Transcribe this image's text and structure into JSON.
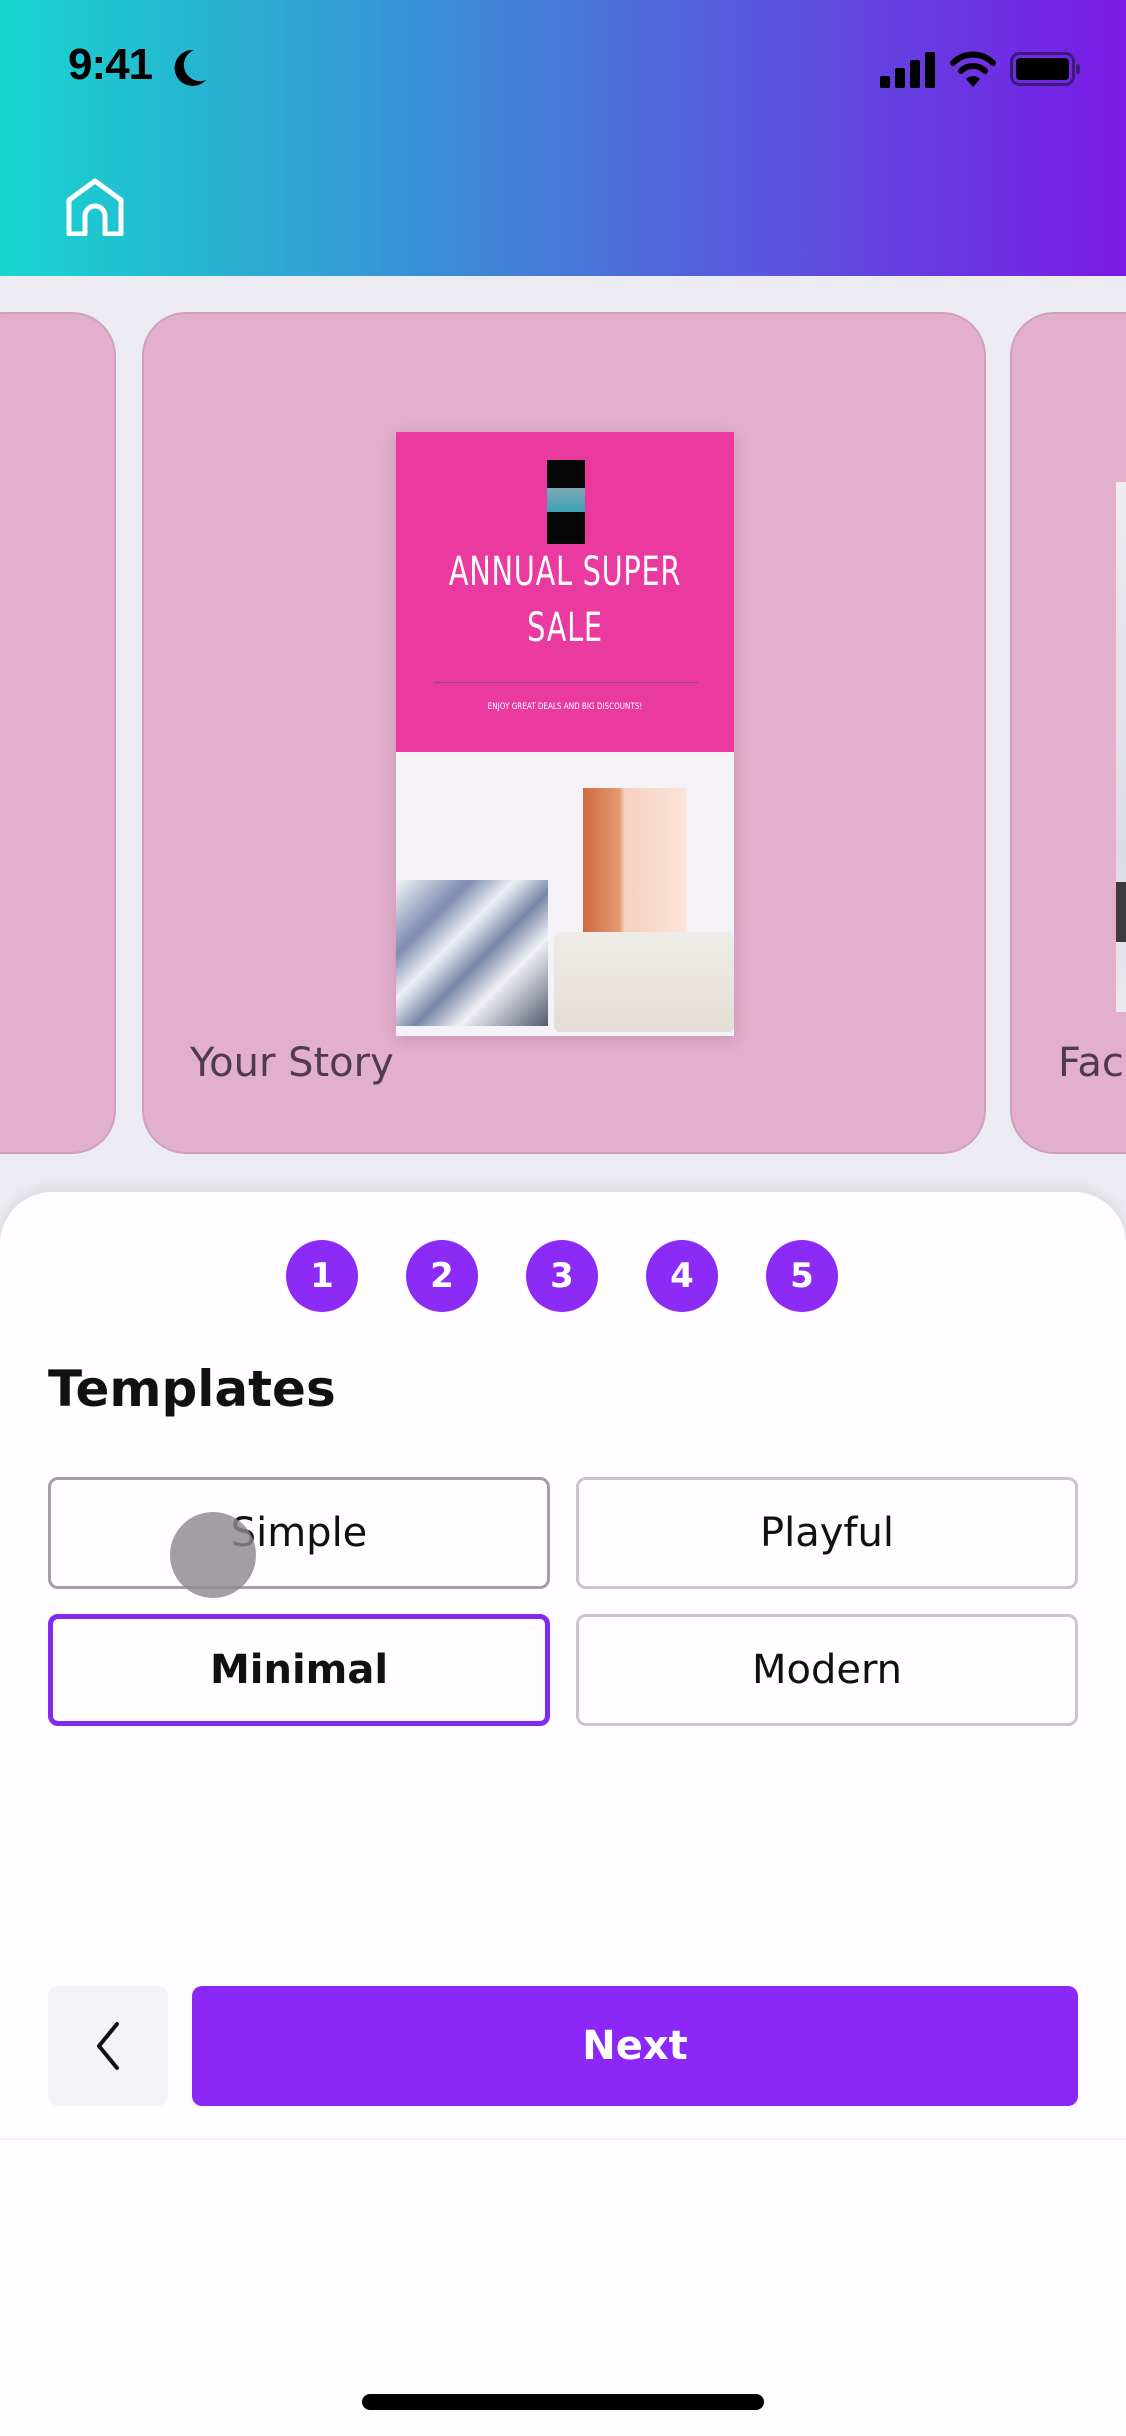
{
  "status_bar": {
    "time": "9:41",
    "icons": [
      "moon-icon",
      "signal-icon",
      "wifi-icon",
      "battery-icon"
    ]
  },
  "header": {
    "home_icon": "home-icon",
    "gradient": [
      "#17d6cf",
      "#7a1ae6"
    ]
  },
  "carousel": {
    "cards": [
      {
        "label": "",
        "position": "previous"
      },
      {
        "label": "Your Story",
        "position": "current",
        "preview": {
          "title": "ANNUAL SUPER SALE",
          "subtitle": "ENJOY GREAT DEALS AND BIG DISCOUNTS!"
        }
      },
      {
        "label": "Fac",
        "position": "next"
      }
    ]
  },
  "steps": [
    "1",
    "2",
    "3",
    "4",
    "5"
  ],
  "templates": {
    "title": "Templates",
    "options": [
      {
        "label": "Simple",
        "selected": false
      },
      {
        "label": "Playful",
        "selected": false
      },
      {
        "label": "Minimal",
        "selected": true
      },
      {
        "label": "Modern",
        "selected": false
      }
    ]
  },
  "footer": {
    "back_icon": "chevron-left-icon",
    "next_label": "Next"
  },
  "colors": {
    "accent": "#8b28f8",
    "card_bg": "#e2b0cd",
    "poster_pink": "#ea3aa0"
  }
}
